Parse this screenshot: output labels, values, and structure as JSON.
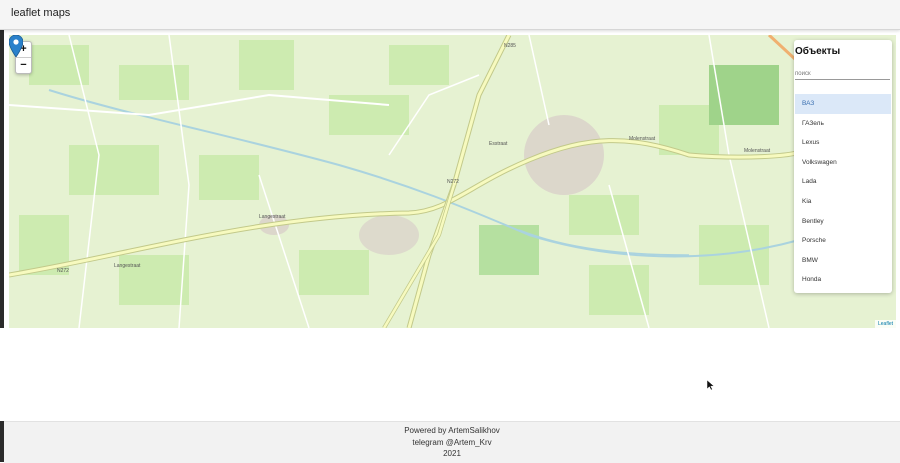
{
  "app": {
    "title": "leaflet maps"
  },
  "map": {
    "zoom_in": "+",
    "zoom_out": "−",
    "attribution": "Leaflet",
    "road_labels": [
      "N285",
      "N272",
      "N272",
      "Langestraat",
      "Langestraat",
      "Molenstraat",
      "Molenstraat",
      "Esstraat"
    ]
  },
  "panel": {
    "title": "Объекты",
    "search_placeholder": "поиск",
    "items": [
      "ВАЗ",
      "ГАЗель",
      "Lexus",
      "Volkswagen",
      "Lada",
      "Kia",
      "Bentley",
      "Porsche",
      "BMW",
      "Honda"
    ],
    "selected_item": "ВАЗ"
  },
  "footer": {
    "line1": "Powered by ArtemSalikhov",
    "line2": "telegram @Artem_Krv",
    "line3": "2021"
  },
  "colors": {
    "map_bg": "#e6f2d2",
    "field": "#cdebb0",
    "road": "#f7fabf",
    "road_outline": "#c2c98a",
    "water": "#aad3df",
    "marker": "#2a81cb",
    "selected_bg": "#dbe8f8"
  }
}
